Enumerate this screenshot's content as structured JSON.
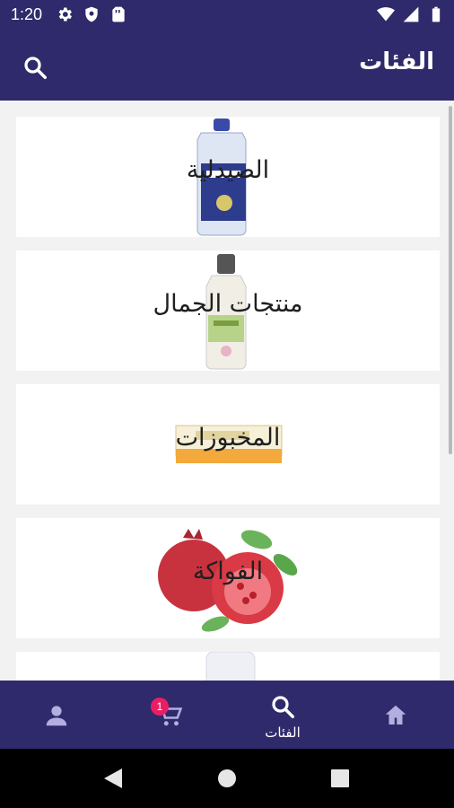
{
  "status_bar": {
    "time": "1:20"
  },
  "app_bar": {
    "title": "الفئات"
  },
  "categories": [
    {
      "label": "الصيدلية"
    },
    {
      "label": "منتجات الجمال"
    },
    {
      "label": "المخبوزات"
    },
    {
      "label": "الفواكة"
    }
  ],
  "bottom_nav": {
    "active_label": "الفئات",
    "cart_badge": "1"
  },
  "colors": {
    "primary": "#2f2a6b",
    "badge": "#e91e63",
    "background": "#f2f2f2"
  },
  "icons": [
    "settings-icon",
    "shield-icon",
    "sim-card-icon",
    "wifi-icon",
    "signal-icon",
    "battery-icon",
    "search-icon",
    "home-icon",
    "cart-icon",
    "profile-icon",
    "back-icon",
    "home-circle-icon",
    "recents-icon"
  ]
}
